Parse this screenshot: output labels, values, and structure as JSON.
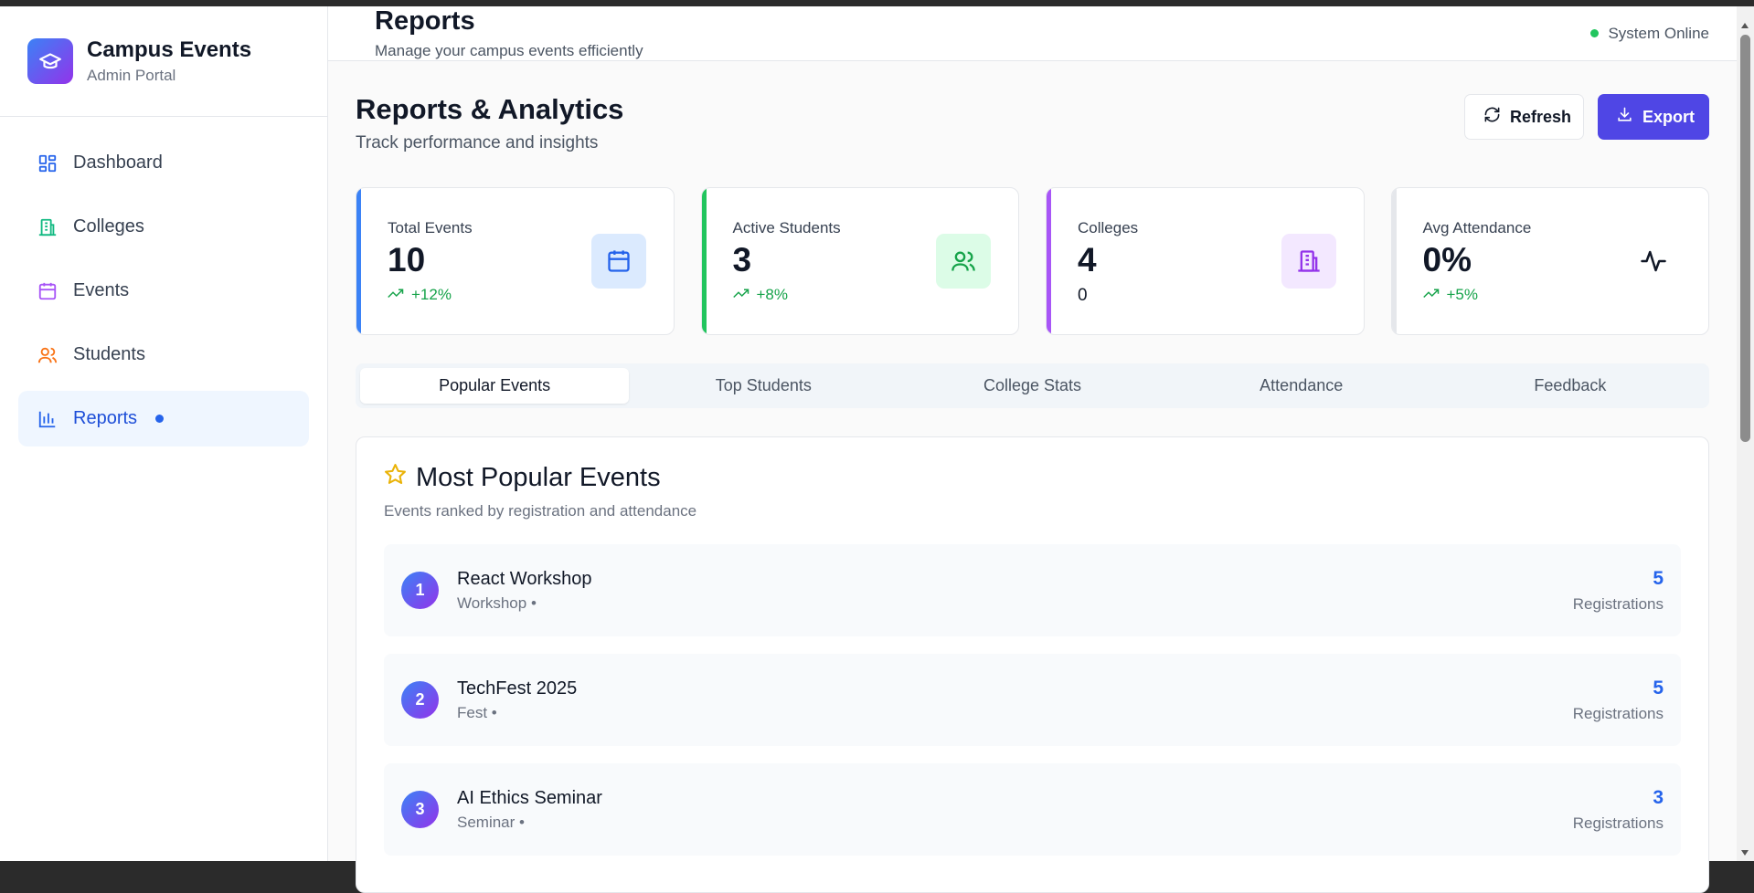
{
  "brand": {
    "title": "Campus Events",
    "subtitle": "Admin Portal"
  },
  "sidebar": {
    "items": [
      {
        "label": "Dashboard",
        "icon": "dashboard-icon"
      },
      {
        "label": "Colleges",
        "icon": "building-icon"
      },
      {
        "label": "Events",
        "icon": "calendar-icon"
      },
      {
        "label": "Students",
        "icon": "users-icon"
      },
      {
        "label": "Reports",
        "icon": "bar-chart-icon",
        "active": true
      }
    ]
  },
  "header": {
    "title": "Reports",
    "subtitle": "Manage your campus events efficiently",
    "status": "System Online"
  },
  "content": {
    "title": "Reports & Analytics",
    "subtitle": "Track performance and insights",
    "refresh_label": "Refresh",
    "export_label": "Export"
  },
  "stats": [
    {
      "label": "Total Events",
      "value": "10",
      "trend": "+12%",
      "color": "#3b82f6"
    },
    {
      "label": "Active Students",
      "value": "3",
      "trend": "+8%",
      "color": "#22c55e"
    },
    {
      "label": "Colleges",
      "value": "4",
      "extra": "0",
      "color": "#a855f7"
    },
    {
      "label": "Avg Attendance",
      "value": "0%",
      "trend": "+5%",
      "color": "#e5e7eb"
    }
  ],
  "tabs": [
    "Popular Events",
    "Top Students",
    "College Stats",
    "Attendance",
    "Feedback"
  ],
  "panel": {
    "title": "Most Popular Events",
    "subtitle": "Events ranked by registration and attendance",
    "rows": [
      {
        "rank": "1",
        "name": "React Workshop",
        "type": "Workshop •",
        "count": "5",
        "count_label": "Registrations"
      },
      {
        "rank": "2",
        "name": "TechFest 2025",
        "type": "Fest •",
        "count": "5",
        "count_label": "Registrations"
      },
      {
        "rank": "3",
        "name": "AI Ethics Seminar",
        "type": "Seminar •",
        "count": "3",
        "count_label": "Registrations"
      }
    ]
  }
}
